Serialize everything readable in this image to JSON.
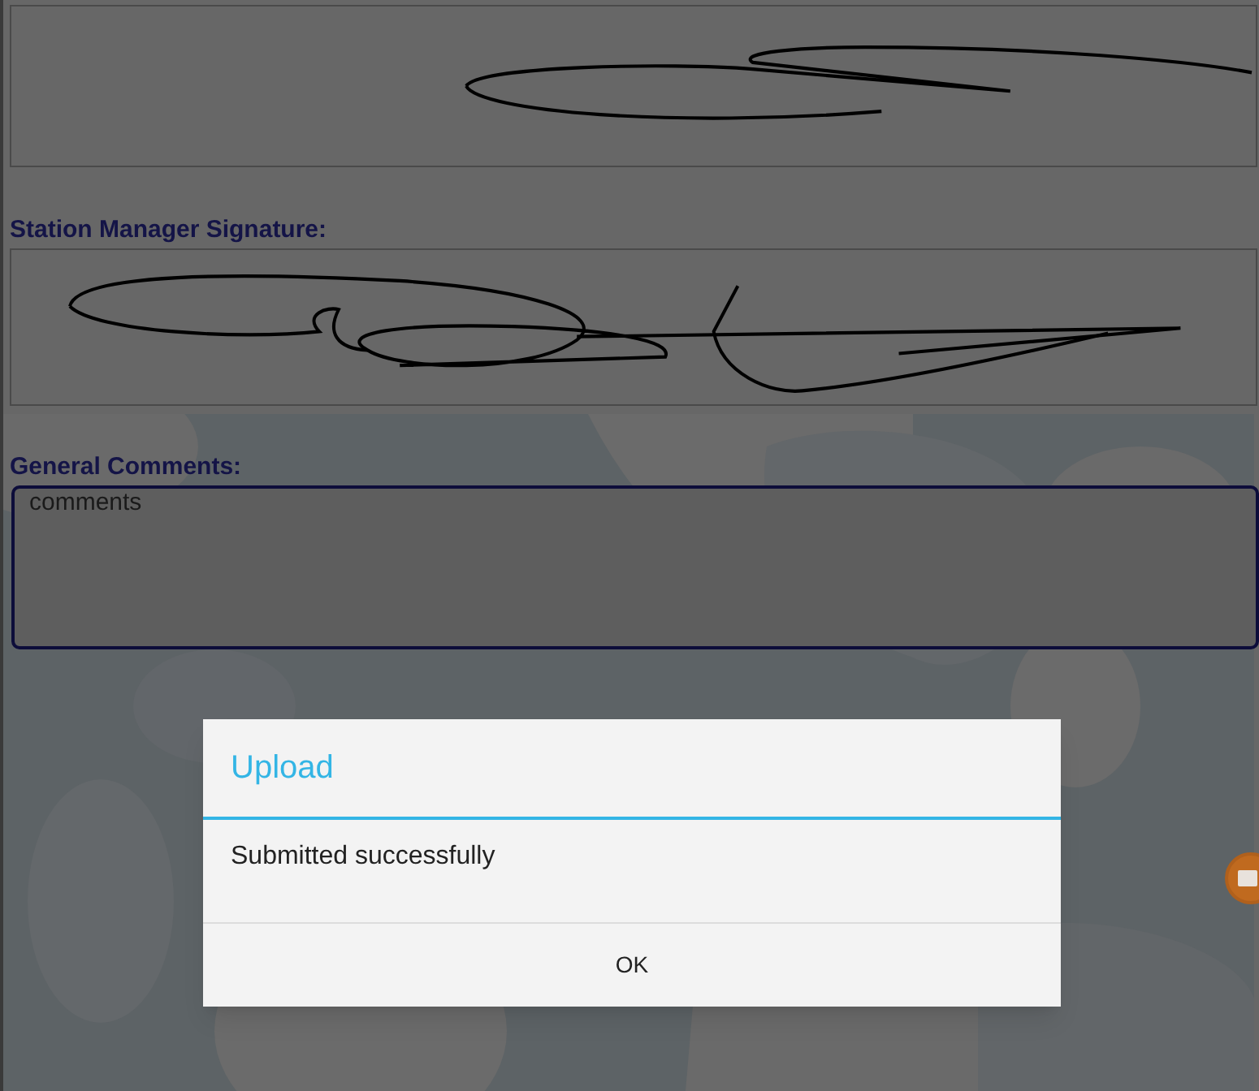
{
  "form": {
    "fields": [
      {
        "kind": "signature_pad"
      },
      {
        "kind": "label",
        "text": "Station Manager Signature:"
      },
      {
        "kind": "signature_pad"
      },
      {
        "kind": "label",
        "text": "General Comments:"
      },
      {
        "kind": "textarea",
        "value": "comments"
      }
    ]
  },
  "dialog": {
    "title": "Upload",
    "message": "Submitted successfully",
    "buttons": [
      "OK"
    ]
  }
}
